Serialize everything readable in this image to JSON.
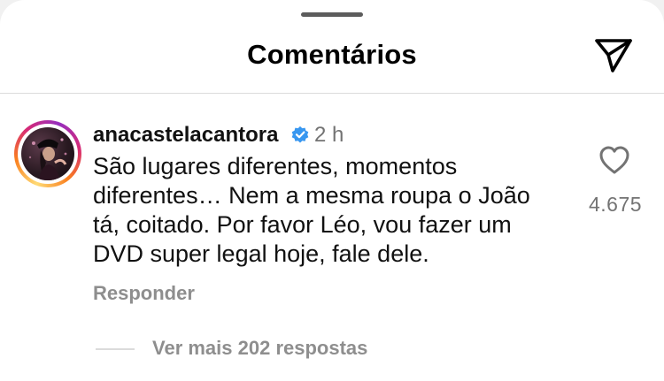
{
  "header": {
    "title": "Comentários",
    "share_icon": "paper-plane-icon"
  },
  "comment": {
    "username": "anacastelacantora",
    "verified": true,
    "verified_color": "#3897f0",
    "timestamp": "2 h",
    "text": "São lugares diferentes, momentos diferentes… Nem a mesma roupa o João tá, coitado. Por favor Léo, vou fazer um DVD super legal hoje, fale dele.",
    "like_icon": "heart-outline-icon",
    "like_count": "4.675",
    "reply_label": "Responder",
    "view_replies_label": "Ver mais 202 respostas"
  },
  "colors": {
    "primary_text": "#111111",
    "secondary_text": "#737373",
    "muted_text": "#8e8e8e",
    "divider": "#dbdbdb"
  }
}
